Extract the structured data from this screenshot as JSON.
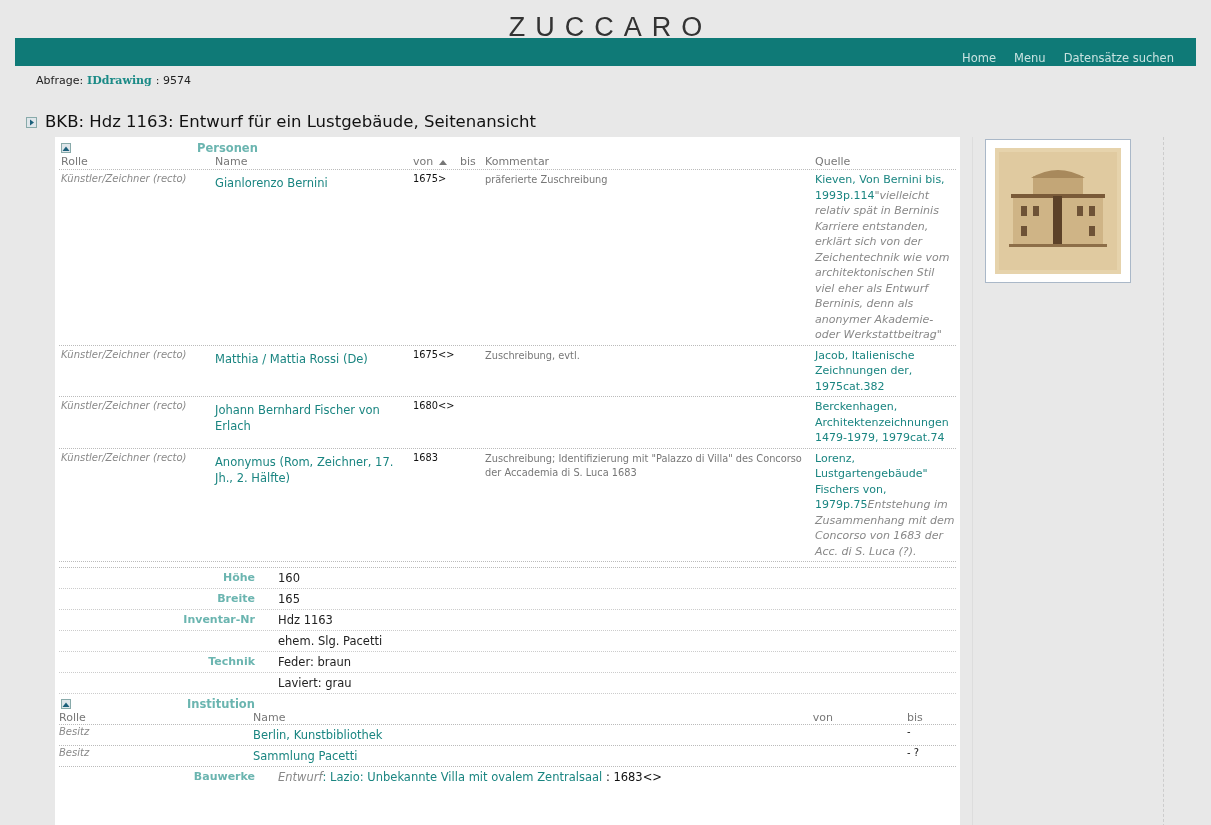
{
  "logo": "ZUCCARO",
  "nav": [
    "Home",
    "Menu",
    "Datensätze suchen"
  ],
  "query": {
    "label": "Abfrage:",
    "field": "IDdrawing",
    "separator": ":",
    "value": "9574"
  },
  "title": "BKB: Hdz 1163: Entwurf für ein Lustgebäude, Seitenansicht",
  "persons": {
    "heading": "Personen",
    "columns": [
      "Rolle",
      "Name",
      "von",
      "bis",
      "Kommentar",
      "Quelle"
    ],
    "rows": [
      {
        "role": "Künstler/Zeichner (recto)",
        "name": "Gianlorenzo Bernini",
        "from": "1675>",
        "comment": "präferierte Zuschreibung",
        "source": "Kieven, Von Bernini bis, 1993p.114",
        "note": "\"vielleicht relativ spät in Berninis Karriere entstanden, erklärt sich von der Zeichentechnik wie vom architektonischen Stil viel eher als Entwurf Berninis, denn als anonymer Akademie- oder Werkstattbeitrag\""
      },
      {
        "role": "Künstler/Zeichner (recto)",
        "name": "Matthia / Mattia Rossi (De)",
        "from": "1675<>",
        "comment": "Zuschreibung, evtl.",
        "source": "Jacob, Italienische Zeichnungen der, 1975cat.382"
      },
      {
        "role": "Künstler/Zeichner (recto)",
        "name": "Johann Bernhard Fischer von Erlach",
        "from": "1680<>",
        "source": "Berckenhagen, Architektenzeichnungen 1479-1979, 1979cat.74"
      },
      {
        "role": "Künstler/Zeichner (recto)",
        "name": "Anonymus (Rom, Zeichner, 17. Jh., 2. Hälfte)",
        "from": "1683",
        "comment": "Zuschreibung; Identifizierung mit \"Palazzo di Villa\" des Concorso der Accademia di S. Luca 1683",
        "source": "Lorenz, Lustgartengebäude\" Fischers von, 1979p.75",
        "note": "Entstehung im Zusammenhang mit dem Concorso von 1683 der Acc. di S. Luca (?)."
      }
    ]
  },
  "properties": [
    {
      "label": "Höhe",
      "value": "160"
    },
    {
      "label": "Breite",
      "value": "165"
    },
    {
      "label": "Inventar-Nr",
      "value": "Hdz 1163"
    },
    {
      "value": "ehem. Slg. Pacetti"
    },
    {
      "label": "Technik",
      "value": "Feder: braun"
    },
    {
      "value": "Laviert: grau"
    }
  ],
  "institution": {
    "heading": "Institution",
    "columns": [
      "Rolle",
      "Name",
      "von",
      "bis"
    ],
    "rows": [
      {
        "role": "Besitz",
        "name": "Berlin, Kunstbibliothek",
        "to": "-"
      },
      {
        "role": "Besitz",
        "name": "Sammlung Pacetti",
        "to": "- ?"
      }
    ]
  },
  "buildings": {
    "label": "Bauwerke",
    "kind": "Entwurf",
    "separator": ":",
    "link": "Lazio: Unbekannte Villa mit ovalem Zentralsaal",
    "date": ": 1683<>"
  },
  "thumbnail": {
    "kind": "picture"
  }
}
